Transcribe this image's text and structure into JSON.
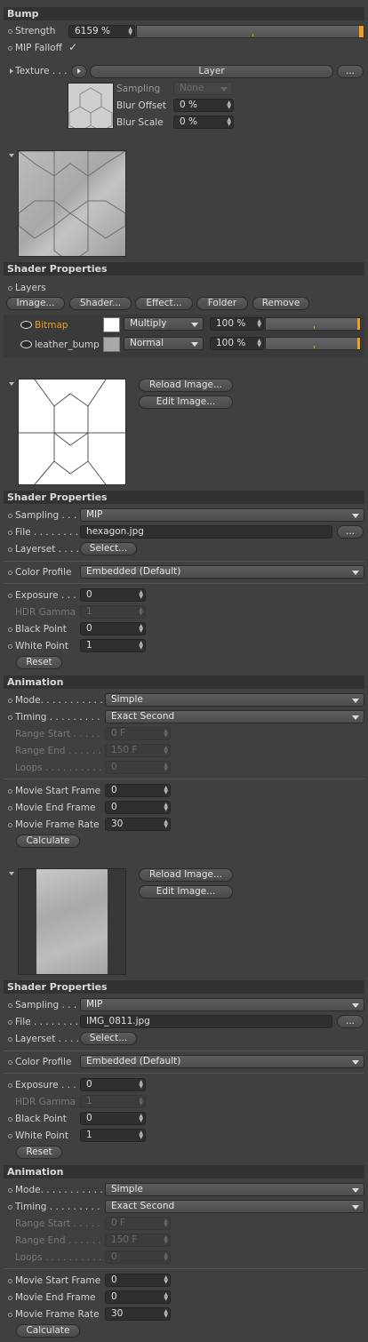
{
  "bump": {
    "title": "Bump",
    "strength_label": "Strength",
    "strength_value": "6159 %",
    "strength_fraction": 1.0,
    "mip_falloff_label": "MIP Falloff",
    "mip_falloff_check": "✓",
    "texture_label": "Texture . . .",
    "texture_shader": "Layer",
    "more_button": "...",
    "sampling_label": "Sampling",
    "sampling_value": "None",
    "blur_offset_label": "Blur Offset",
    "blur_offset_value": "0 %",
    "blur_scale_label": "Blur Scale",
    "blur_scale_value": "0 %"
  },
  "layer_props": {
    "title": "Shader Properties",
    "layers_label": "Layers",
    "buttons": [
      "Image...",
      "Shader...",
      "Effect...",
      "Folder",
      "Remove"
    ],
    "rows": [
      {
        "name": "Bitmap",
        "mode": "Multiply",
        "opacity": "100 %",
        "fraction": 1.0,
        "color": "#f0a020"
      },
      {
        "name": "leather_bump",
        "mode": "Normal",
        "opacity": "100 %",
        "fraction": 1.0,
        "color": "#cfcfcf"
      }
    ],
    "reload_button": "Reload Image...",
    "edit_button": "Edit Image..."
  },
  "bitmap1": {
    "props_title": "Shader Properties",
    "sampling_label": "Sampling . . .",
    "sampling_value": "MIP",
    "file_label": "File . . . . . . . .",
    "file_value": "hexagon.jpg",
    "more_button": "...",
    "layerset_label": "Layerset . . . .",
    "layerset_button": "Select...",
    "color_profile_label": "Color Profile",
    "color_profile_value": "Embedded (Default)",
    "exposure_label": "Exposure . . .",
    "exposure_value": "0",
    "hdr_gamma_label": "HDR Gamma",
    "hdr_gamma_value": "1",
    "black_point_label": "Black Point",
    "black_point_value": "0",
    "white_point_label": "White Point",
    "white_point_value": "1",
    "reset_button": "Reset",
    "anim_title": "Animation",
    "mode_label": "Mode. . . . . . . . . . .",
    "mode_value": "Simple",
    "timing_label": "Timing . . . . . . . . .",
    "timing_value": "Exact Second",
    "range_start_label": "Range Start . . . . .",
    "range_start_value": "0 F",
    "range_end_label": "Range End . . . . . .",
    "range_end_value": "150 F",
    "loops_label": "Loops . . . . . . . . . .",
    "loops_value": "0",
    "movie_start_label": "Movie Start Frame",
    "movie_start_value": "0",
    "movie_end_label": "Movie End Frame",
    "movie_end_value": "0",
    "movie_rate_label": "Movie Frame Rate",
    "movie_rate_value": "30",
    "calculate_button": "Calculate",
    "reload_button": "Reload Image...",
    "edit_button": "Edit Image..."
  },
  "bitmap2": {
    "props_title": "Shader Properties",
    "sampling_label": "Sampling . . .",
    "sampling_value": "MIP",
    "file_label": "File . . . . . . . .",
    "file_value": "IMG_0811.jpg",
    "more_button": "...",
    "layerset_label": "Layerset . . . .",
    "layerset_button": "Select...",
    "color_profile_label": "Color Profile",
    "color_profile_value": "Embedded (Default)",
    "exposure_label": "Exposure . . .",
    "exposure_value": "0",
    "hdr_gamma_label": "HDR Gamma",
    "hdr_gamma_value": "1",
    "black_point_label": "Black Point",
    "black_point_value": "0",
    "white_point_label": "White Point",
    "white_point_value": "1",
    "reset_button": "Reset",
    "anim_title": "Animation",
    "mode_label": "Mode. . . . . . . . . . .",
    "mode_value": "Simple",
    "timing_label": "Timing . . . . . . . . .",
    "timing_value": "Exact Second",
    "range_start_label": "Range Start . . . . .",
    "range_start_value": "0 F",
    "range_end_label": "Range End . . . . . .",
    "range_end_value": "150 F",
    "loops_label": "Loops . . . . . . . . . .",
    "loops_value": "0",
    "movie_start_label": "Movie Start Frame",
    "movie_start_value": "0",
    "movie_end_label": "Movie End Frame",
    "movie_end_value": "0",
    "movie_rate_label": "Movie Frame Rate",
    "movie_rate_value": "30",
    "calculate_button": "Calculate"
  },
  "colors": {
    "accent": "#f0a020",
    "panel": "#404040",
    "header": "#323232"
  }
}
